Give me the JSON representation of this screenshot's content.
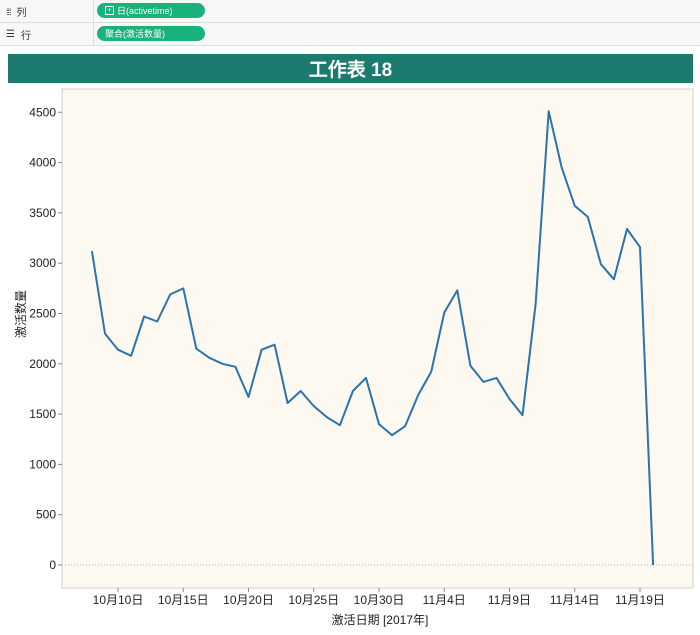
{
  "shelves": {
    "columns": {
      "label": "列",
      "pill": "日(activetime)"
    },
    "rows": {
      "label": "行",
      "pill": "聚合(激活数量)"
    }
  },
  "colors": {
    "accent": "#1c7a6e",
    "pill": "#1ab27b",
    "line": "#2b73ad",
    "plot_bg": "#fdf9f0"
  },
  "chart_data": {
    "type": "line",
    "title": "工作表 18",
    "xlabel": "激活日期 [2017年]",
    "ylabel": "激活数量",
    "ylim": [
      0,
      4700
    ],
    "yticks": [
      0,
      500,
      1000,
      1500,
      2000,
      2500,
      3000,
      3500,
      4000,
      4500
    ],
    "xticks": [
      {
        "date": "2017-10-10",
        "label": "10月10日"
      },
      {
        "date": "2017-10-15",
        "label": "10月15日"
      },
      {
        "date": "2017-10-20",
        "label": "10月20日"
      },
      {
        "date": "2017-10-25",
        "label": "10月25日"
      },
      {
        "date": "2017-10-30",
        "label": "10月30日"
      },
      {
        "date": "2017-11-04",
        "label": "11月4日"
      },
      {
        "date": "2017-11-09",
        "label": "11月9日"
      },
      {
        "date": "2017-11-14",
        "label": "11月14日"
      },
      {
        "date": "2017-11-19",
        "label": "11月19日"
      }
    ],
    "x": [
      "2017-10-08",
      "2017-10-09",
      "2017-10-10",
      "2017-10-11",
      "2017-10-12",
      "2017-10-13",
      "2017-10-14",
      "2017-10-15",
      "2017-10-16",
      "2017-10-17",
      "2017-10-18",
      "2017-10-19",
      "2017-10-20",
      "2017-10-21",
      "2017-10-22",
      "2017-10-23",
      "2017-10-24",
      "2017-10-25",
      "2017-10-26",
      "2017-10-27",
      "2017-10-28",
      "2017-10-29",
      "2017-10-30",
      "2017-10-31",
      "2017-11-01",
      "2017-11-02",
      "2017-11-03",
      "2017-11-04",
      "2017-11-05",
      "2017-11-06",
      "2017-11-07",
      "2017-11-08",
      "2017-11-09",
      "2017-11-10",
      "2017-11-11",
      "2017-11-12",
      "2017-11-13",
      "2017-11-14",
      "2017-11-15",
      "2017-11-16",
      "2017-11-17",
      "2017-11-18",
      "2017-11-19",
      "2017-11-20"
    ],
    "values": [
      3120,
      2300,
      2140,
      2080,
      2470,
      2420,
      2690,
      2750,
      2150,
      2060,
      2000,
      1970,
      1670,
      2140,
      2190,
      1610,
      1730,
      1580,
      1470,
      1390,
      1730,
      1860,
      1400,
      1290,
      1380,
      1690,
      1920,
      2510,
      2730,
      1980,
      1820,
      1860,
      1650,
      1490,
      2590,
      4510,
      3950,
      3570,
      3460,
      2990,
      2840,
      3340,
      3160,
      0
    ],
    "grid": false
  }
}
